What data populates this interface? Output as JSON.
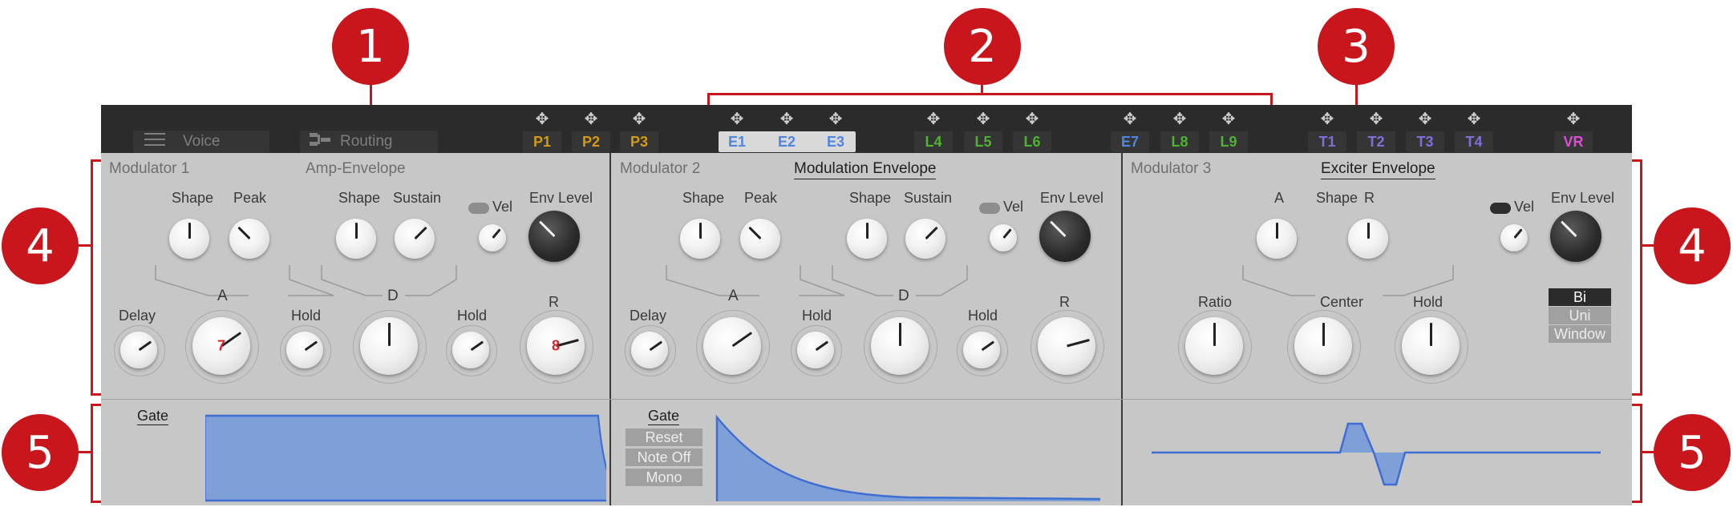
{
  "callouts": [
    "1",
    "2",
    "3",
    "4",
    "4",
    "5",
    "5"
  ],
  "topbar": {
    "voice_label": "Voice",
    "routing_label": "Routing",
    "slots": [
      {
        "label": "P1",
        "color": "#d39a16"
      },
      {
        "label": "P2",
        "color": "#d39a16"
      },
      {
        "label": "P3",
        "color": "#d39a16"
      },
      {
        "label": "E1",
        "color": "#4e86e0"
      },
      {
        "label": "E2",
        "color": "#4e86e0"
      },
      {
        "label": "E3",
        "color": "#4e86e0"
      },
      {
        "label": "L4",
        "color": "#4fb232"
      },
      {
        "label": "L5",
        "color": "#4fb232"
      },
      {
        "label": "L6",
        "color": "#4fb232"
      },
      {
        "label": "E7",
        "color": "#4e86e0"
      },
      {
        "label": "L8",
        "color": "#4fb232"
      },
      {
        "label": "L9",
        "color": "#4fb232"
      },
      {
        "label": "T1",
        "color": "#7d6fd8"
      },
      {
        "label": "T2",
        "color": "#7d6fd8"
      },
      {
        "label": "T3",
        "color": "#7d6fd8"
      },
      {
        "label": "T4",
        "color": "#7d6fd8"
      },
      {
        "label": "VR",
        "color": "#d84fd0"
      }
    ]
  },
  "mod1": {
    "title": "Modulator 1",
    "env_title": "Amp-Envelope",
    "shape1": "Shape",
    "peak": "Peak",
    "shape2": "Shape",
    "sustain": "Sustain",
    "vel": "Vel",
    "env_level": "Env Level",
    "a": "A",
    "d": "D",
    "r": "R",
    "delay": "Delay",
    "hold1": "Hold",
    "hold2": "Hold",
    "a_value": "7",
    "r_value": "8",
    "gate": "Gate"
  },
  "mod2": {
    "title": "Modulator 2",
    "env_title": "Modulation Envelope",
    "shape1": "Shape",
    "peak": "Peak",
    "shape2": "Shape",
    "sustain": "Sustain",
    "vel": "Vel",
    "env_level": "Env Level",
    "a": "A",
    "d": "D",
    "r": "R",
    "delay": "Delay",
    "hold1": "Hold",
    "hold2": "Hold",
    "gate": "Gate",
    "reset": "Reset",
    "note_off": "Note Off",
    "mono": "Mono"
  },
  "mod3": {
    "title": "Modulator 3",
    "env_title": "Exciter Envelope",
    "a": "A",
    "shape": "Shape",
    "r": "R",
    "vel": "Vel",
    "env_level": "Env Level",
    "ratio": "Ratio",
    "center": "Center",
    "hold": "Hold",
    "bi": "Bi",
    "uni": "Uni",
    "window": "Window"
  }
}
